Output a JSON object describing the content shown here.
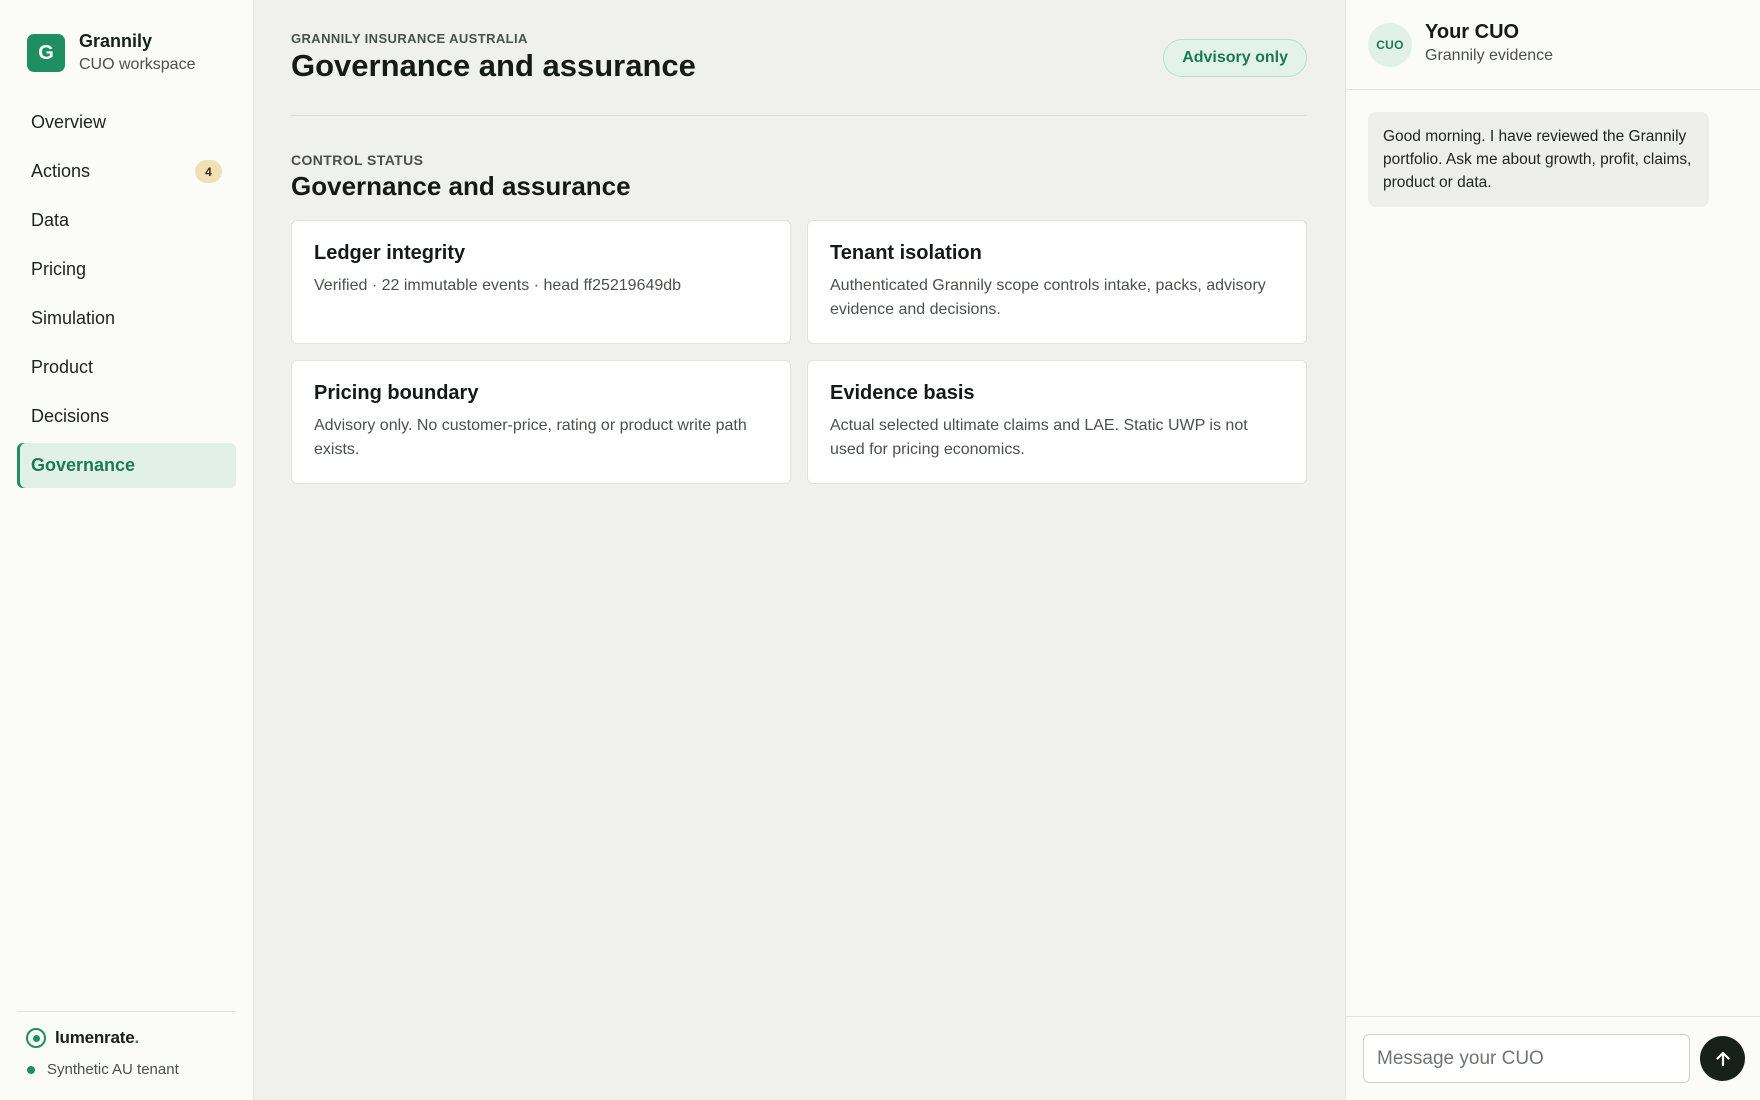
{
  "brand": {
    "logo_letter": "G",
    "name": "Grannily",
    "subtitle": "CUO workspace"
  },
  "sidebar": {
    "items": [
      {
        "label": "Overview",
        "active": false
      },
      {
        "label": "Actions",
        "badge": "4",
        "active": false
      },
      {
        "label": "Data",
        "active": false
      },
      {
        "label": "Pricing",
        "active": false
      },
      {
        "label": "Simulation",
        "active": false
      },
      {
        "label": "Product",
        "active": false
      },
      {
        "label": "Decisions",
        "active": false
      },
      {
        "label": "Governance",
        "active": true
      }
    ],
    "footer": {
      "product_name": "lumenrate",
      "product_dot": ".",
      "tenant": "Synthetic AU tenant"
    }
  },
  "header": {
    "eyebrow": "GRANNILY INSURANCE AUSTRALIA",
    "title": "Governance and assurance",
    "pill": "Advisory only"
  },
  "section": {
    "eyebrow": "CONTROL STATUS",
    "title": "Governance and assurance",
    "cards": [
      {
        "title": "Ledger integrity",
        "body": "Verified · 22 immutable events · head ff25219649db"
      },
      {
        "title": "Tenant isolation",
        "body": "Authenticated Grannily scope controls intake, packs, advisory evidence and decisions."
      },
      {
        "title": "Pricing boundary",
        "body": "Advisory only. No customer-price, rating or product write path exists."
      },
      {
        "title": "Evidence basis",
        "body": "Actual selected ultimate claims and LAE. Static UWP is not used for pricing economics."
      }
    ]
  },
  "chat": {
    "avatar": "CUO",
    "title": "Your CUO",
    "subtitle": "Grannily evidence",
    "messages": [
      {
        "text": "Good morning. I have reviewed the Grannily portfolio. Ask me about growth, profit, claims, product or data."
      }
    ],
    "input_placeholder": "Message your CUO",
    "send_icon": "arrow-up-icon"
  },
  "colors": {
    "accent": "#1f8f62",
    "accent_soft": "#e1f1ea",
    "badge": "#f1dfb6",
    "dark": "#17201b"
  }
}
